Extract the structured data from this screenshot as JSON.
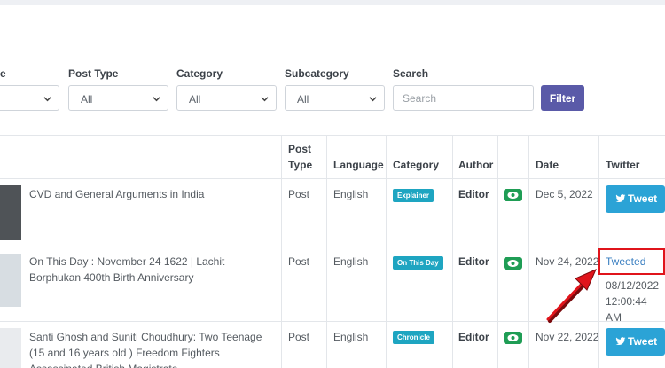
{
  "filters": {
    "language_label_partial": "e",
    "post_type": {
      "label": "Post Type",
      "value": "All"
    },
    "category": {
      "label": "Category",
      "value": "All"
    },
    "subcategory": {
      "label": "Subcategory",
      "value": "All"
    },
    "search": {
      "label": "Search",
      "placeholder": "Search"
    },
    "filter_button": "Filter"
  },
  "table": {
    "headers": {
      "post_type": "Post Type",
      "language": "Language",
      "category": "Category",
      "author": "Author",
      "date": "Date",
      "twitter": "Twitter"
    },
    "rows": [
      {
        "title": "CVD and General Arguments in India",
        "post_type": "Post",
        "language": "English",
        "category": "Explainer",
        "author": "Editor",
        "date": "Dec 5, 2022",
        "twitter_button": "Tweet"
      },
      {
        "title": "On This Day : November 24 1622 | Lachit Borphukan 400th Birth Anniversary",
        "post_type": "Post",
        "language": "English",
        "category": "On This Day",
        "author": "Editor",
        "date": "Nov 24, 2022",
        "twitter_status": "Tweeted",
        "twitter_date": "08/12/2022",
        "twitter_time": "12:00:44 AM"
      },
      {
        "title": "Santi Ghosh and Suniti Choudhury: Two Teenage (15 and 16 years old ) Freedom Fighters Assassinated British Magistrate",
        "post_type": "Post",
        "language": "English",
        "category": "Chronicle",
        "author": "Editor",
        "date": "Nov 22, 2022",
        "twitter_button": "Tweet"
      }
    ]
  },
  "colors": {
    "accent": "#5a5aa8",
    "badge": "#1ea5c1",
    "eye_button": "#1f9d55",
    "tweet_button": "#2ba3d6",
    "annotation": "#e0141b"
  },
  "icons": [
    "chevron-down-icon",
    "eye-icon",
    "twitter-bird-icon",
    "red-arrow-annotation"
  ]
}
